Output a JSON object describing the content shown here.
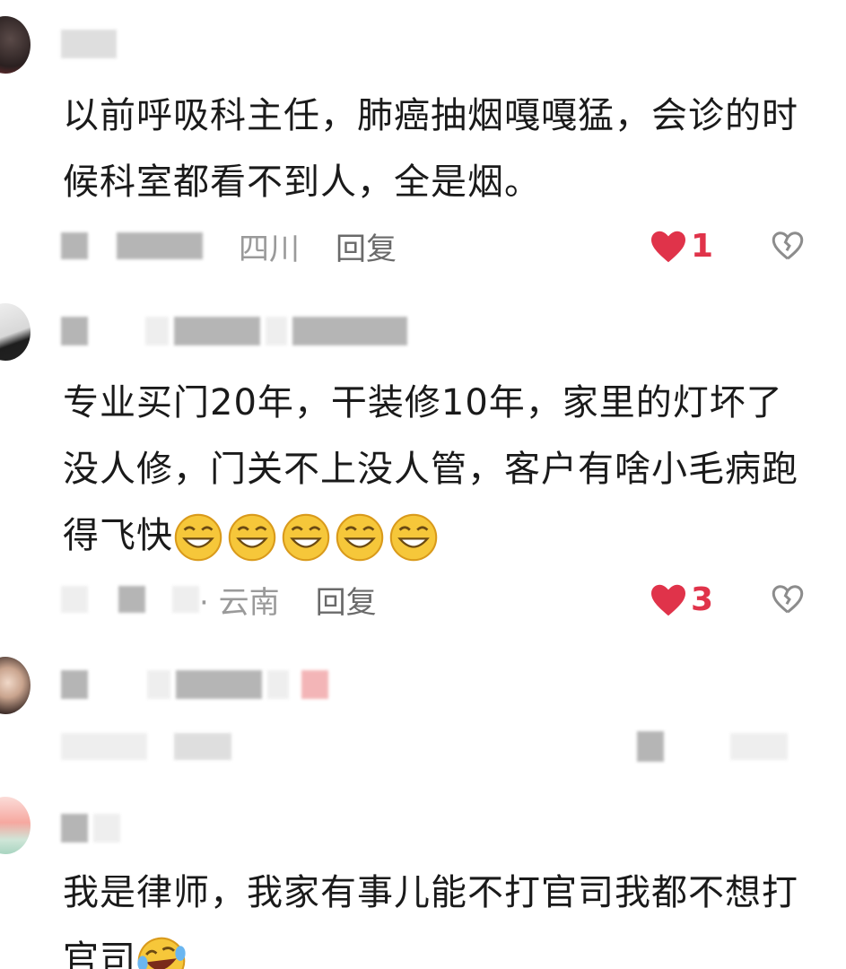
{
  "comments": [
    {
      "text": "以前呼吸科主任，肺癌抽烟嘎嘎猛，会诊的时候科室都看不到人，全是烟。",
      "location": "四川",
      "reply_label": "回复",
      "likes": "1"
    },
    {
      "text": "专业买门20年，干装修10年，家里的灯坏了没人修，门关不上没人管，客户有啥小毛病跑得飞快",
      "location": "· 云南",
      "reply_label": "回复",
      "likes": "3"
    },
    {
      "text": "",
      "location": "",
      "reply_label": "",
      "likes": ""
    },
    {
      "text": "我是律师，我家有事儿能不打官司我都不想打官司",
      "location": "",
      "reply_label": "",
      "likes": ""
    }
  ],
  "icons": {
    "like": "heart-icon",
    "dislike": "broken-heart-icon",
    "emoji_grin": "grinning-squint-emoji",
    "emoji_laugh": "laughing-tears-emoji"
  },
  "colors": {
    "like": "#e0334a",
    "text": "#1a1a1a",
    "meta": "#9a9a9a"
  }
}
